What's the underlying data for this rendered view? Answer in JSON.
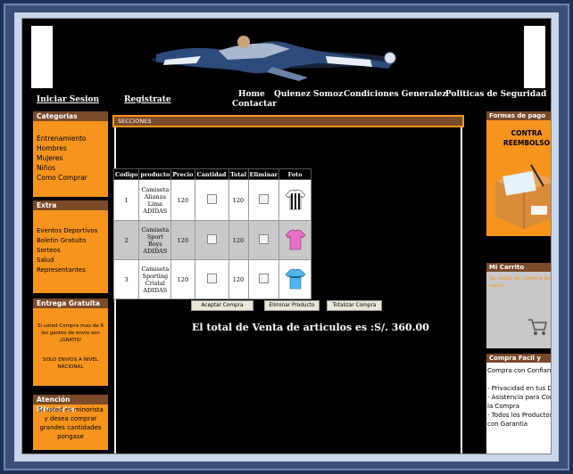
{
  "nav": {
    "login": "Iniciar Sesion",
    "register": "Registrate",
    "home": "Home",
    "about": "Quienez Somoz",
    "terms": "Condiciones Generalez",
    "policies": "Politicas de Seguridad",
    "contact": "Contactar"
  },
  "left": {
    "categorias": {
      "title": "Categorias",
      "items": [
        "Entrenamiento",
        "Hombres",
        "Mujeres",
        "Niños",
        "Como Comprar"
      ]
    },
    "extra": {
      "title": "Extra",
      "items": [
        "Eventos Deportivos",
        "Boletin Gratuito",
        "Sorteos",
        "Salud",
        "Representantes"
      ]
    },
    "entrega": {
      "title": "Entrega Gratuita",
      "line1": "Si usted Compra mas de 6 los gastos de envio son ¡GRATIS!",
      "line2": "SOLO ENVIOS A NIVEL NACIONAL"
    },
    "atencion": {
      "title": "Atención Minoristas",
      "text": "Si usted es minorista y desea comprar grandes cantidades pongase"
    }
  },
  "main": {
    "section_title": "SECCIONES",
    "table": {
      "headers": [
        "Codigo",
        "producto",
        "Precio",
        "Cantidad",
        "Total",
        "Eliminar",
        "Foto"
      ],
      "rows": [
        {
          "codigo": "1",
          "producto": "Camiseta Alianza Lima ADIDAS",
          "precio": "120",
          "total": "120",
          "shirt": "striped-black-white"
        },
        {
          "codigo": "2",
          "producto": "Camiseta Sport Boys ADIDAS",
          "precio": "120",
          "total": "120",
          "shirt": "pink"
        },
        {
          "codigo": "3",
          "producto": "Camiseta Sporting Cristal ADIDAS",
          "precio": "120",
          "total": "120",
          "shirt": "sky-blue"
        }
      ]
    },
    "buttons": {
      "accept": "Aceptar Compra",
      "delete": "Eliminar Producto",
      "total": "Totalizar Compra"
    },
    "total_text": "El total de Venta de articulos es :S/. 360.00"
  },
  "right": {
    "pago": {
      "title": "Formas de pago",
      "contra": "CONTRA REEMBOLSO"
    },
    "carrito": {
      "title": "Mi Carrito",
      "empty": "Su cesta de compra esta vacia"
    },
    "seguro": {
      "title": "Compra Facil y Seguro",
      "lines": [
        "Compra con Confianza",
        "- Privacidad en tus Datos",
        "- Asistencia para Comrar la Compra",
        "- Todos los Productos con Garantia"
      ]
    }
  },
  "colors": {
    "accent_orange": "#f7941d",
    "header_brown": "#7b4a2a",
    "page_bg": "#000000"
  }
}
